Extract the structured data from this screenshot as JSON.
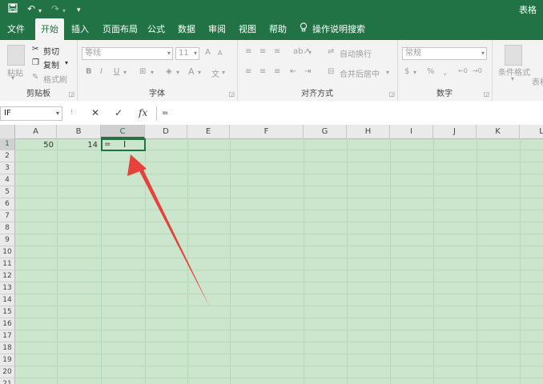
{
  "app": {
    "doc_title": "表格"
  },
  "quick_access": {
    "save_icon": "save-icon",
    "undo_icon": "undo-icon",
    "redo_icon": "redo-icon",
    "customize_icon": "customize-icon"
  },
  "menu": {
    "tabs": [
      {
        "label": "文件"
      },
      {
        "label": "开始",
        "active": true
      },
      {
        "label": "插入"
      },
      {
        "label": "页面布局"
      },
      {
        "label": "公式"
      },
      {
        "label": "数据"
      },
      {
        "label": "审阅"
      },
      {
        "label": "视图"
      },
      {
        "label": "帮助"
      },
      {
        "label": "操作说明搜索"
      }
    ]
  },
  "ribbon": {
    "clipboard": {
      "paste": "粘贴",
      "cut": "剪切",
      "copy": "复制",
      "format_painter": "格式刷",
      "group": "剪贴板"
    },
    "font": {
      "font_name": "等线",
      "font_size": "11",
      "grow": "A",
      "shrink": "A",
      "bold": "B",
      "italic": "I",
      "underline": "U",
      "font_color": "A",
      "group": "字体"
    },
    "alignment": {
      "wrap_text": "自动换行",
      "merge_center": "合并后居中",
      "group": "对齐方式"
    },
    "number": {
      "format": "常规",
      "percent": "%",
      "comma": ",",
      "group": "数字"
    },
    "styles": {
      "conditional_format": "条件格式",
      "table_format": "表格"
    }
  },
  "formula_bar": {
    "name_box": "IF",
    "cancel": "✕",
    "enter": "✓",
    "fx": "fx",
    "formula": "="
  },
  "sheet": {
    "columns": [
      "A",
      "B",
      "C",
      "D",
      "E",
      "F",
      "G",
      "H",
      "I",
      "J",
      "K",
      "L"
    ],
    "rows": [
      "1",
      "2",
      "3",
      "4",
      "5",
      "6",
      "7",
      "8",
      "9",
      "10",
      "11",
      "12",
      "13",
      "14",
      "15",
      "16",
      "17",
      "18",
      "19",
      "20",
      "21"
    ],
    "cells": {
      "A1": "50",
      "B1": "14",
      "C1": "="
    },
    "active_cell": "C1"
  },
  "colors": {
    "brand": "#217346",
    "sheet_bg": "#cbe6cc",
    "arrow": "#e8403b"
  }
}
